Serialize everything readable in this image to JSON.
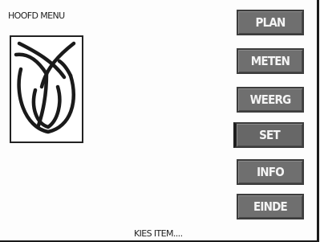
{
  "header": {
    "title": "HOOFD MENU"
  },
  "logo": {
    "icon": "tulip-logo-icon"
  },
  "menu": {
    "buttons": [
      {
        "label": "PLAN"
      },
      {
        "label": "METEN"
      },
      {
        "label": "WEERG"
      },
      {
        "label": "SET",
        "selected": true
      },
      {
        "label": "INFO"
      },
      {
        "label": "EINDE"
      }
    ]
  },
  "status": {
    "text": "KIES ITEM...."
  },
  "colors": {
    "button_fill": "#6f6f6f",
    "button_text": "#f4f4f4",
    "background": "#fdfdfd"
  }
}
